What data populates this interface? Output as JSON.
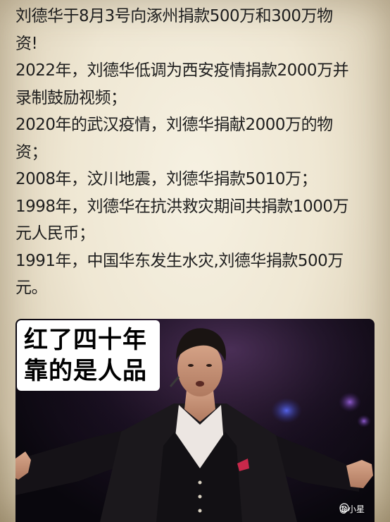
{
  "lines": [
    "刘德华于8月3号向涿州捐款500万和300万物",
    "资!",
    "2022年，刘德华低调为西安疫情捐款2000万并",
    "录制鼓励视频；",
    "2020年的武汉疫情，刘德华捐献2000万的物",
    "资；",
    "2008年，汶川地震，刘德华捐款5010万；",
    "1998年，刘德华在抗洪救灾期间共捐款1000万",
    "元人民币；",
    "1991年，中国华东发生水灾,刘德华捐款500万",
    "元。"
  ],
  "image": {
    "caption_line1": "红了四十年",
    "caption_line2": "靠的是人品",
    "icon": "performer-photo"
  },
  "watermark": {
    "icon": "platform-logo-icon",
    "text": "@小星"
  },
  "colors": {
    "background": "#efe7d3",
    "text": "#1e1e1e",
    "photo_bg": "#120b18",
    "caption_bg": "#ffffff",
    "caption_text": "#000000"
  }
}
